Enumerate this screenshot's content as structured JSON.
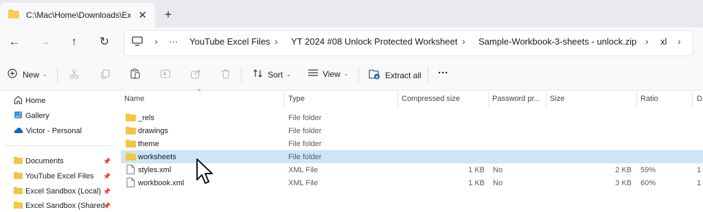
{
  "tab": {
    "title": "C:\\Mac\\Home\\Downloads\\Exc",
    "close": "✕",
    "new_tab": "+"
  },
  "nav": {
    "back": "←",
    "forward": "→",
    "up": "↑",
    "refresh": "↻"
  },
  "address": {
    "more": "···",
    "separator": "›",
    "crumbs": [
      "YouTube Excel Files",
      "YT 2024 #08 Unlock Protected Worksheet",
      "Sample-Workbook-3-sheets - unlock.zip",
      "xl"
    ]
  },
  "commands": {
    "new": "New",
    "sort": "Sort",
    "view": "View",
    "extract_all": "Extract all",
    "more": "···"
  },
  "sidebar": {
    "top": [
      {
        "label": "Home",
        "icon": "home-icon"
      },
      {
        "label": "Gallery",
        "icon": "gallery-icon"
      },
      {
        "label": "Victor - Personal",
        "icon": "onedrive-icon"
      }
    ],
    "pinned": [
      {
        "label": "Documents"
      },
      {
        "label": "YouTube Excel Files"
      },
      {
        "label": "Excel Sandbox (Local)"
      },
      {
        "label": "Excel Sandbox (Shared"
      }
    ]
  },
  "columns": [
    "Name",
    "Type",
    "Compressed size",
    "Password pr...",
    "Size",
    "Ratio",
    "D"
  ],
  "files": [
    {
      "name": "_rels",
      "type": "File folder",
      "compressed": "",
      "password": "",
      "size": "",
      "ratio": "",
      "date": "",
      "kind": "folder"
    },
    {
      "name": "drawings",
      "type": "File folder",
      "compressed": "",
      "password": "",
      "size": "",
      "ratio": "",
      "date": "",
      "kind": "folder"
    },
    {
      "name": "theme",
      "type": "File folder",
      "compressed": "",
      "password": "",
      "size": "",
      "ratio": "",
      "date": "",
      "kind": "folder"
    },
    {
      "name": "worksheets",
      "type": "File folder",
      "compressed": "",
      "password": "",
      "size": "",
      "ratio": "",
      "date": "",
      "kind": "folder",
      "selected": true
    },
    {
      "name": "styles.xml",
      "type": "XML File",
      "compressed": "1 KB",
      "password": "No",
      "size": "2 KB",
      "ratio": "59%",
      "date": "1",
      "kind": "file"
    },
    {
      "name": "workbook.xml",
      "type": "XML File",
      "compressed": "1 KB",
      "password": "No",
      "size": "3 KB",
      "ratio": "60%",
      "date": "1",
      "kind": "file"
    }
  ],
  "colors": {
    "folder": "#f5c542",
    "folder_dark": "#e0a820",
    "selection": "#cce5f7",
    "accent": "#0f6cbd"
  }
}
